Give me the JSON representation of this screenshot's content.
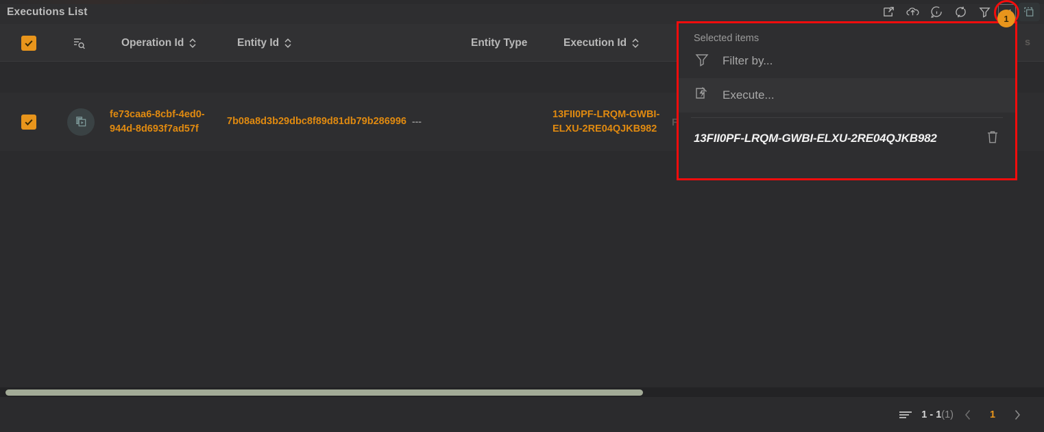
{
  "window": {
    "title": "Executions List"
  },
  "toolbar": {
    "items": [
      {
        "name": "new-window-icon",
        "label": ""
      },
      {
        "name": "cloud-upload-icon",
        "label": ""
      },
      {
        "name": "info-icon",
        "label": ""
      },
      {
        "name": "refresh-icon",
        "label": ""
      },
      {
        "name": "filter-icon",
        "label": ""
      },
      {
        "name": "selected-items-icon",
        "label": ""
      },
      {
        "name": "select-area-icon",
        "label": ""
      }
    ],
    "selected_badge_count": "1",
    "highlight_color": "#f50c0c",
    "accent_color": "#e8951c"
  },
  "table": {
    "columns": [
      {
        "label": "",
        "sortable": false,
        "name": "select-all"
      },
      {
        "label": "",
        "sortable": false,
        "name": "row-actions"
      },
      {
        "label": "Operation Id",
        "sortable": true,
        "name": "operation-id"
      },
      {
        "label": "Entity Id",
        "sortable": true,
        "name": "entity-id"
      },
      {
        "label": "Entity Type",
        "sortable": false,
        "name": "entity-type"
      },
      {
        "label": "Execution Id",
        "sortable": true,
        "name": "execution-id"
      }
    ],
    "rows": [
      {
        "selected": true,
        "operation_id": "fe73caa6-8cbf-4ed0-944d-8d693f7ad57f",
        "entity_id": "7b08a8d3b29dbc8f89d81db79b286996",
        "entity_id_suffix": "---",
        "entity_type": "",
        "execution_id": "13FII0PF-LRQM-GWBI-ELXU-2RE04QJKB982",
        "partial_next_column": "F"
      }
    ]
  },
  "popup": {
    "title": "Selected items",
    "actions": [
      {
        "label": "Filter by...",
        "icon": "filter-icon"
      },
      {
        "label": "Execute...",
        "icon": "execute-icon"
      }
    ],
    "selected_items": [
      {
        "id": "13FII0PF-LRQM-GWBI-ELXU-2RE04QJKB982",
        "delete_icon": "trash-icon"
      }
    ]
  },
  "footer": {
    "rows_icon": "rows-icon",
    "range": "1 - 1",
    "total": "(1)",
    "prev_label": "‹",
    "current_page": "1",
    "next_label": "›"
  }
}
